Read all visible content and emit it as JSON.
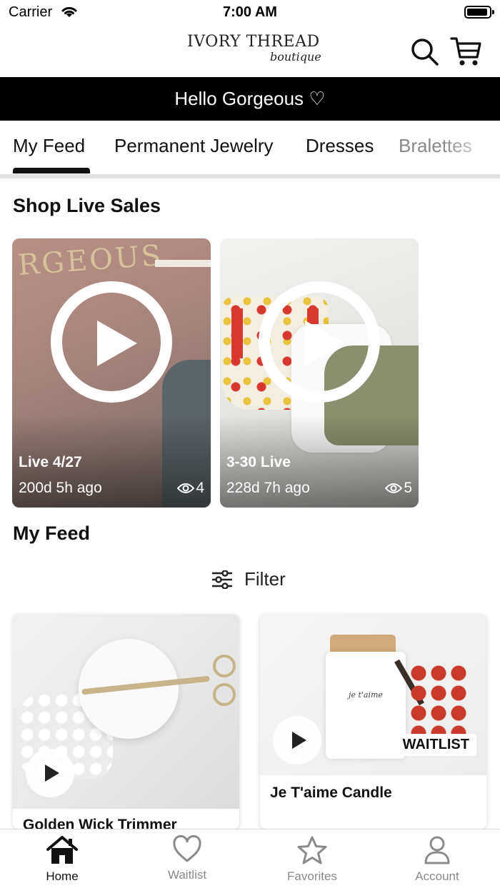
{
  "status_bar": {
    "carrier": "Carrier",
    "time": "7:00 AM"
  },
  "header": {
    "logo_main": "IVORY THREAD",
    "logo_sub": "boutique",
    "search_icon": "search-icon",
    "cart_icon": "cart-icon"
  },
  "banner": {
    "text": "Hello Gorgeous ♡"
  },
  "tabs": [
    {
      "label": "My Feed",
      "active": true
    },
    {
      "label": "Permanent Jewelry",
      "active": false
    },
    {
      "label": "Dresses",
      "active": false
    },
    {
      "label": "Bralettes",
      "active": false
    }
  ],
  "live_section": {
    "title": "Shop Live Sales"
  },
  "live_cards": [
    {
      "title": "Live 4/27",
      "ago": "200d 5h ago",
      "views": "4",
      "wall_text": "RGEOUS"
    },
    {
      "title": "3-30 Live",
      "ago": "228d 7h ago",
      "views": "5"
    }
  ],
  "feed_section": {
    "title": "My Feed",
    "filter_label": "Filter"
  },
  "products": [
    {
      "name": "Golden Wick Trimmer",
      "badge": ""
    },
    {
      "name": "Je T'aime Candle",
      "badge": "WAITLIST",
      "jar_label": "je t'aime"
    }
  ],
  "bottom_nav": [
    {
      "label": "Home",
      "icon": "home-icon",
      "active": true
    },
    {
      "label": "Waitlist",
      "icon": "heart-icon",
      "active": false
    },
    {
      "label": "Favorites",
      "icon": "star-icon",
      "active": false
    },
    {
      "label": "Account",
      "icon": "person-icon",
      "active": false
    }
  ],
  "colors": {
    "banner_bg": "#000000",
    "active_nav": "#111111",
    "inactive_nav": "#8a8a8a"
  }
}
